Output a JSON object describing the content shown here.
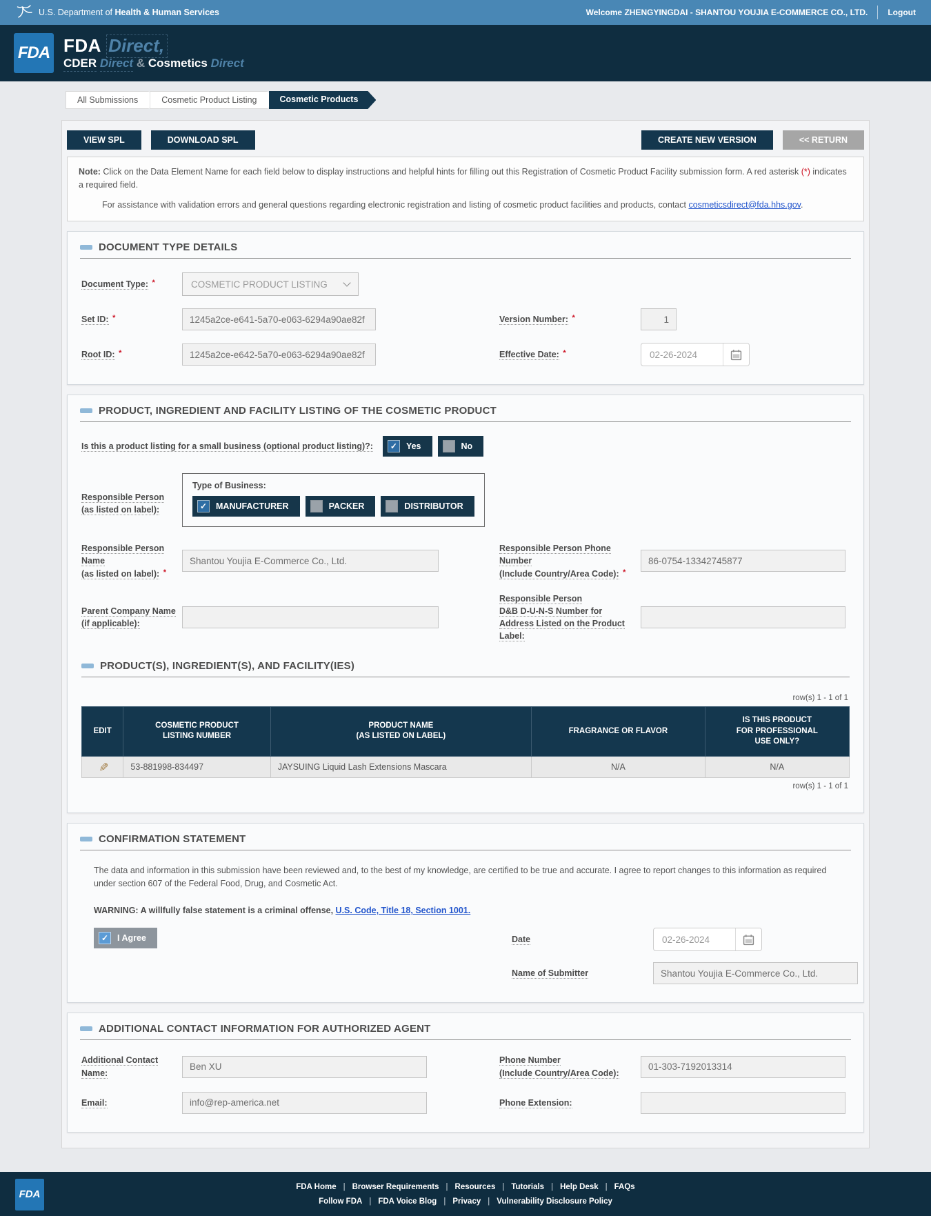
{
  "misc": {
    "asterisk": "*"
  },
  "topbar": {
    "dept_normal": "U.S. Department of",
    "dept_bold": "Health & Human Services",
    "welcome": "Welcome ZHENGYINGDAI - SHANTOU YOUJIA E-COMMERCE CO., LTD.",
    "logout": "Logout"
  },
  "header": {
    "logo": "FDA",
    "line1_fda": "FDA",
    "line1_direct": "Direct,",
    "line2_cder": "CDER",
    "line2_direct": "Direct",
    "line2_amp": "&",
    "line2_cosmetics": "Cosmetics",
    "line2_direct2": "Direct"
  },
  "breadcrumbs": [
    {
      "label": "All Submissions"
    },
    {
      "label": "Cosmetic Product Listing"
    },
    {
      "label": "Cosmetic Products"
    }
  ],
  "toolbar": {
    "view_spl": "VIEW SPL",
    "download_spl": "DOWNLOAD SPL",
    "create_new_version": "CREATE NEW VERSION",
    "return_label": "<< RETURN"
  },
  "note": {
    "prefix": "Note:",
    "body1a": " Click on the Data Element Name for each field below to display instructions and helpful hints for filling out this Registration of Cosmetic Product Facility submission form. A red asterisk ",
    "asterisk": "(*)",
    "body1b": " indicates a required field.",
    "line2a": "For assistance with validation errors and general questions regarding electronic registration and listing of cosmetic product facilities and products, contact ",
    "link": "cosmeticsdirect@fda.hhs.gov",
    "line2b": "."
  },
  "doc_section": {
    "title": "DOCUMENT TYPE DETAILS",
    "document_type": {
      "label": "Document Type:",
      "value": "COSMETIC PRODUCT LISTING"
    },
    "set_id": {
      "label": "Set ID:",
      "value": "1245a2ce-e641-5a70-e063-6294a90ae82f"
    },
    "root_id": {
      "label": "Root ID:",
      "value": "1245a2ce-e642-5a70-e063-6294a90ae82f"
    },
    "version_number": {
      "label": "Version Number:",
      "value": "1"
    },
    "effective_date": {
      "label": "Effective Date:",
      "value": "02-26-2024"
    }
  },
  "product_section": {
    "title": "PRODUCT, INGREDIENT AND FACILITY LISTING OF THE COSMETIC PRODUCT",
    "small_business_question": "Is this a product listing for a small business (optional product listing)?:",
    "yes": "Yes",
    "no": "No",
    "rp_label_lines": [
      "Responsible Person",
      "(as listed on label):"
    ],
    "type_of_business_label": "Type of Business:",
    "business_types": [
      "MANUFACTURER",
      "PACKER",
      "DISTRIBUTOR"
    ],
    "rp_name": {
      "label_lines": [
        "Responsible Person",
        "Name",
        "(as listed on label):"
      ],
      "value": "Shantou Youjia E-Commerce Co., Ltd."
    },
    "rp_phone": {
      "label_lines": [
        "Responsible Person Phone",
        "Number",
        "(Include Country/Area Code):"
      ],
      "value": "86-0754-13342745877"
    },
    "parent_company": {
      "label_lines": [
        "Parent Company Name",
        "(if applicable):"
      ],
      "value": ""
    },
    "duns": {
      "label_lines": [
        "Responsible Person",
        "D&B D-U-N-S Number for",
        "Address Listed on the Product",
        "Label:"
      ],
      "value": ""
    },
    "table_title": "PRODUCT(S), INGREDIENT(S), AND FACILITY(IES)",
    "rows_count": "row(s) 1 - 1 of 1",
    "table": {
      "headers": [
        {
          "lines": [
            "EDIT"
          ]
        },
        {
          "lines": [
            "COSMETIC PRODUCT",
            "LISTING NUMBER"
          ]
        },
        {
          "lines": [
            "PRODUCT NAME",
            "(AS LISTED ON LABEL)"
          ]
        },
        {
          "lines": [
            "FRAGRANCE OR FLAVOR"
          ]
        },
        {
          "lines": [
            "IS THIS PRODUCT",
            "FOR PROFESSIONAL",
            "USE ONLY?"
          ]
        }
      ],
      "rows": [
        {
          "listing_number": "53-881998-834497",
          "product_name": "JAYSUING Liquid Lash Extensions Mascara",
          "fragrance": "N/A",
          "professional": "N/A"
        }
      ]
    }
  },
  "confirmation_section": {
    "title": "CONFIRMATION STATEMENT",
    "statement": "The data and information in this submission have been reviewed and, to the best of my knowledge, are certified to be true and accurate. I agree to report changes to this information as required under section 607 of the Federal Food, Drug, and Cosmetic Act.",
    "warning_prefix": "WARNING: A willfully false statement is a criminal offense, ",
    "warning_link": "U.S. Code, Title 18, Section 1001.",
    "i_agree": "I Agree",
    "date_label": "Date",
    "date_value": "02-26-2024",
    "submitter_label": "Name of Submitter",
    "submitter_value": "Shantou Youjia E-Commerce Co., Ltd."
  },
  "contact_section": {
    "title": "ADDITIONAL CONTACT INFORMATION FOR AUTHORIZED AGENT",
    "name": {
      "label_lines": [
        "Additional Contact",
        "Name:"
      ],
      "value": "Ben XU"
    },
    "phone": {
      "label_lines": [
        "Phone Number",
        "(Include Country/Area Code):"
      ],
      "value": "01-303-7192013314"
    },
    "email": {
      "label_lines": [
        "Email:"
      ],
      "value": "info@rep-america.net"
    },
    "extension": {
      "label_lines": [
        "Phone Extension:"
      ],
      "value": ""
    }
  },
  "footer": {
    "logo": "FDA",
    "separator": "|",
    "row1": [
      "FDA Home",
      "Browser Requirements",
      "Resources",
      "Tutorials",
      "Help Desk",
      "FAQs"
    ],
    "row2": [
      "Follow FDA",
      "FDA Voice Blog",
      "Privacy",
      "Vulnerability Disclosure Policy"
    ]
  }
}
